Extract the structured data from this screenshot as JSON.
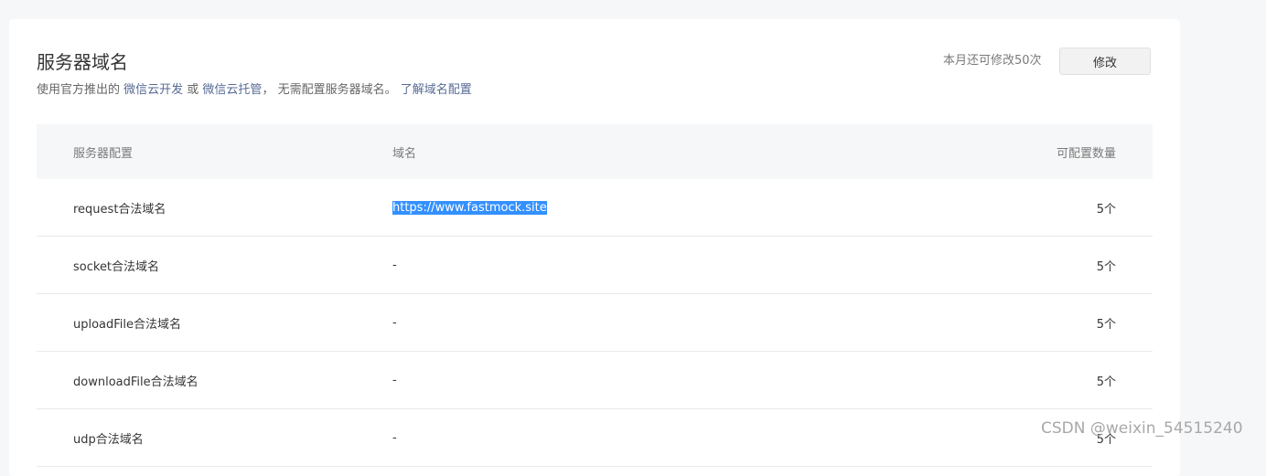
{
  "section": {
    "title": "服务器域名",
    "desc_prefix": "使用官方推出的 ",
    "link_cloud_dev": "微信云开发",
    "desc_or": " 或 ",
    "link_cloud_host": "微信云托管",
    "desc_suffix": "， 无需配置服务器域名。 ",
    "link_learn": "了解域名配置",
    "quota_text": "本月还可修改50次",
    "edit_label": "修改"
  },
  "table": {
    "headers": [
      "服务器配置",
      "域名",
      "可配置数量"
    ],
    "rows": [
      {
        "config": "request合法域名",
        "domain": "https://www.fastmock.site",
        "count": "5个"
      },
      {
        "config": "socket合法域名",
        "domain": "-",
        "count": "5个"
      },
      {
        "config": "uploadFile合法域名",
        "domain": "-",
        "count": "5个"
      },
      {
        "config": "downloadFile合法域名",
        "domain": "-",
        "count": "5个"
      },
      {
        "config": "udp合法域名",
        "domain": "-",
        "count": "5个"
      }
    ]
  },
  "watermark": "CSDN @weixin_54515240"
}
